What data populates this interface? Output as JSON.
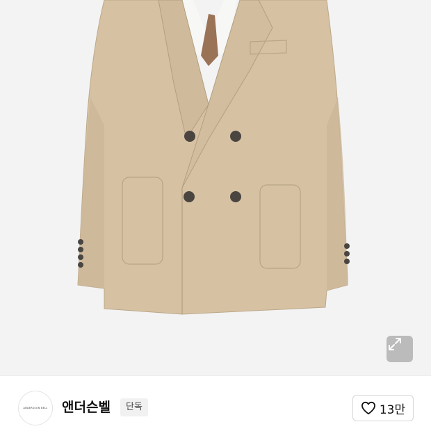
{
  "product": {
    "image_subject": "beige double-breasted jacket",
    "expand_icon": "expand-icon"
  },
  "brand": {
    "logo_text": "ANDERSSON BELL",
    "name": "앤더슨벨",
    "badge": "단독"
  },
  "like": {
    "icon": "heart-outline-icon",
    "count": "13만"
  }
}
